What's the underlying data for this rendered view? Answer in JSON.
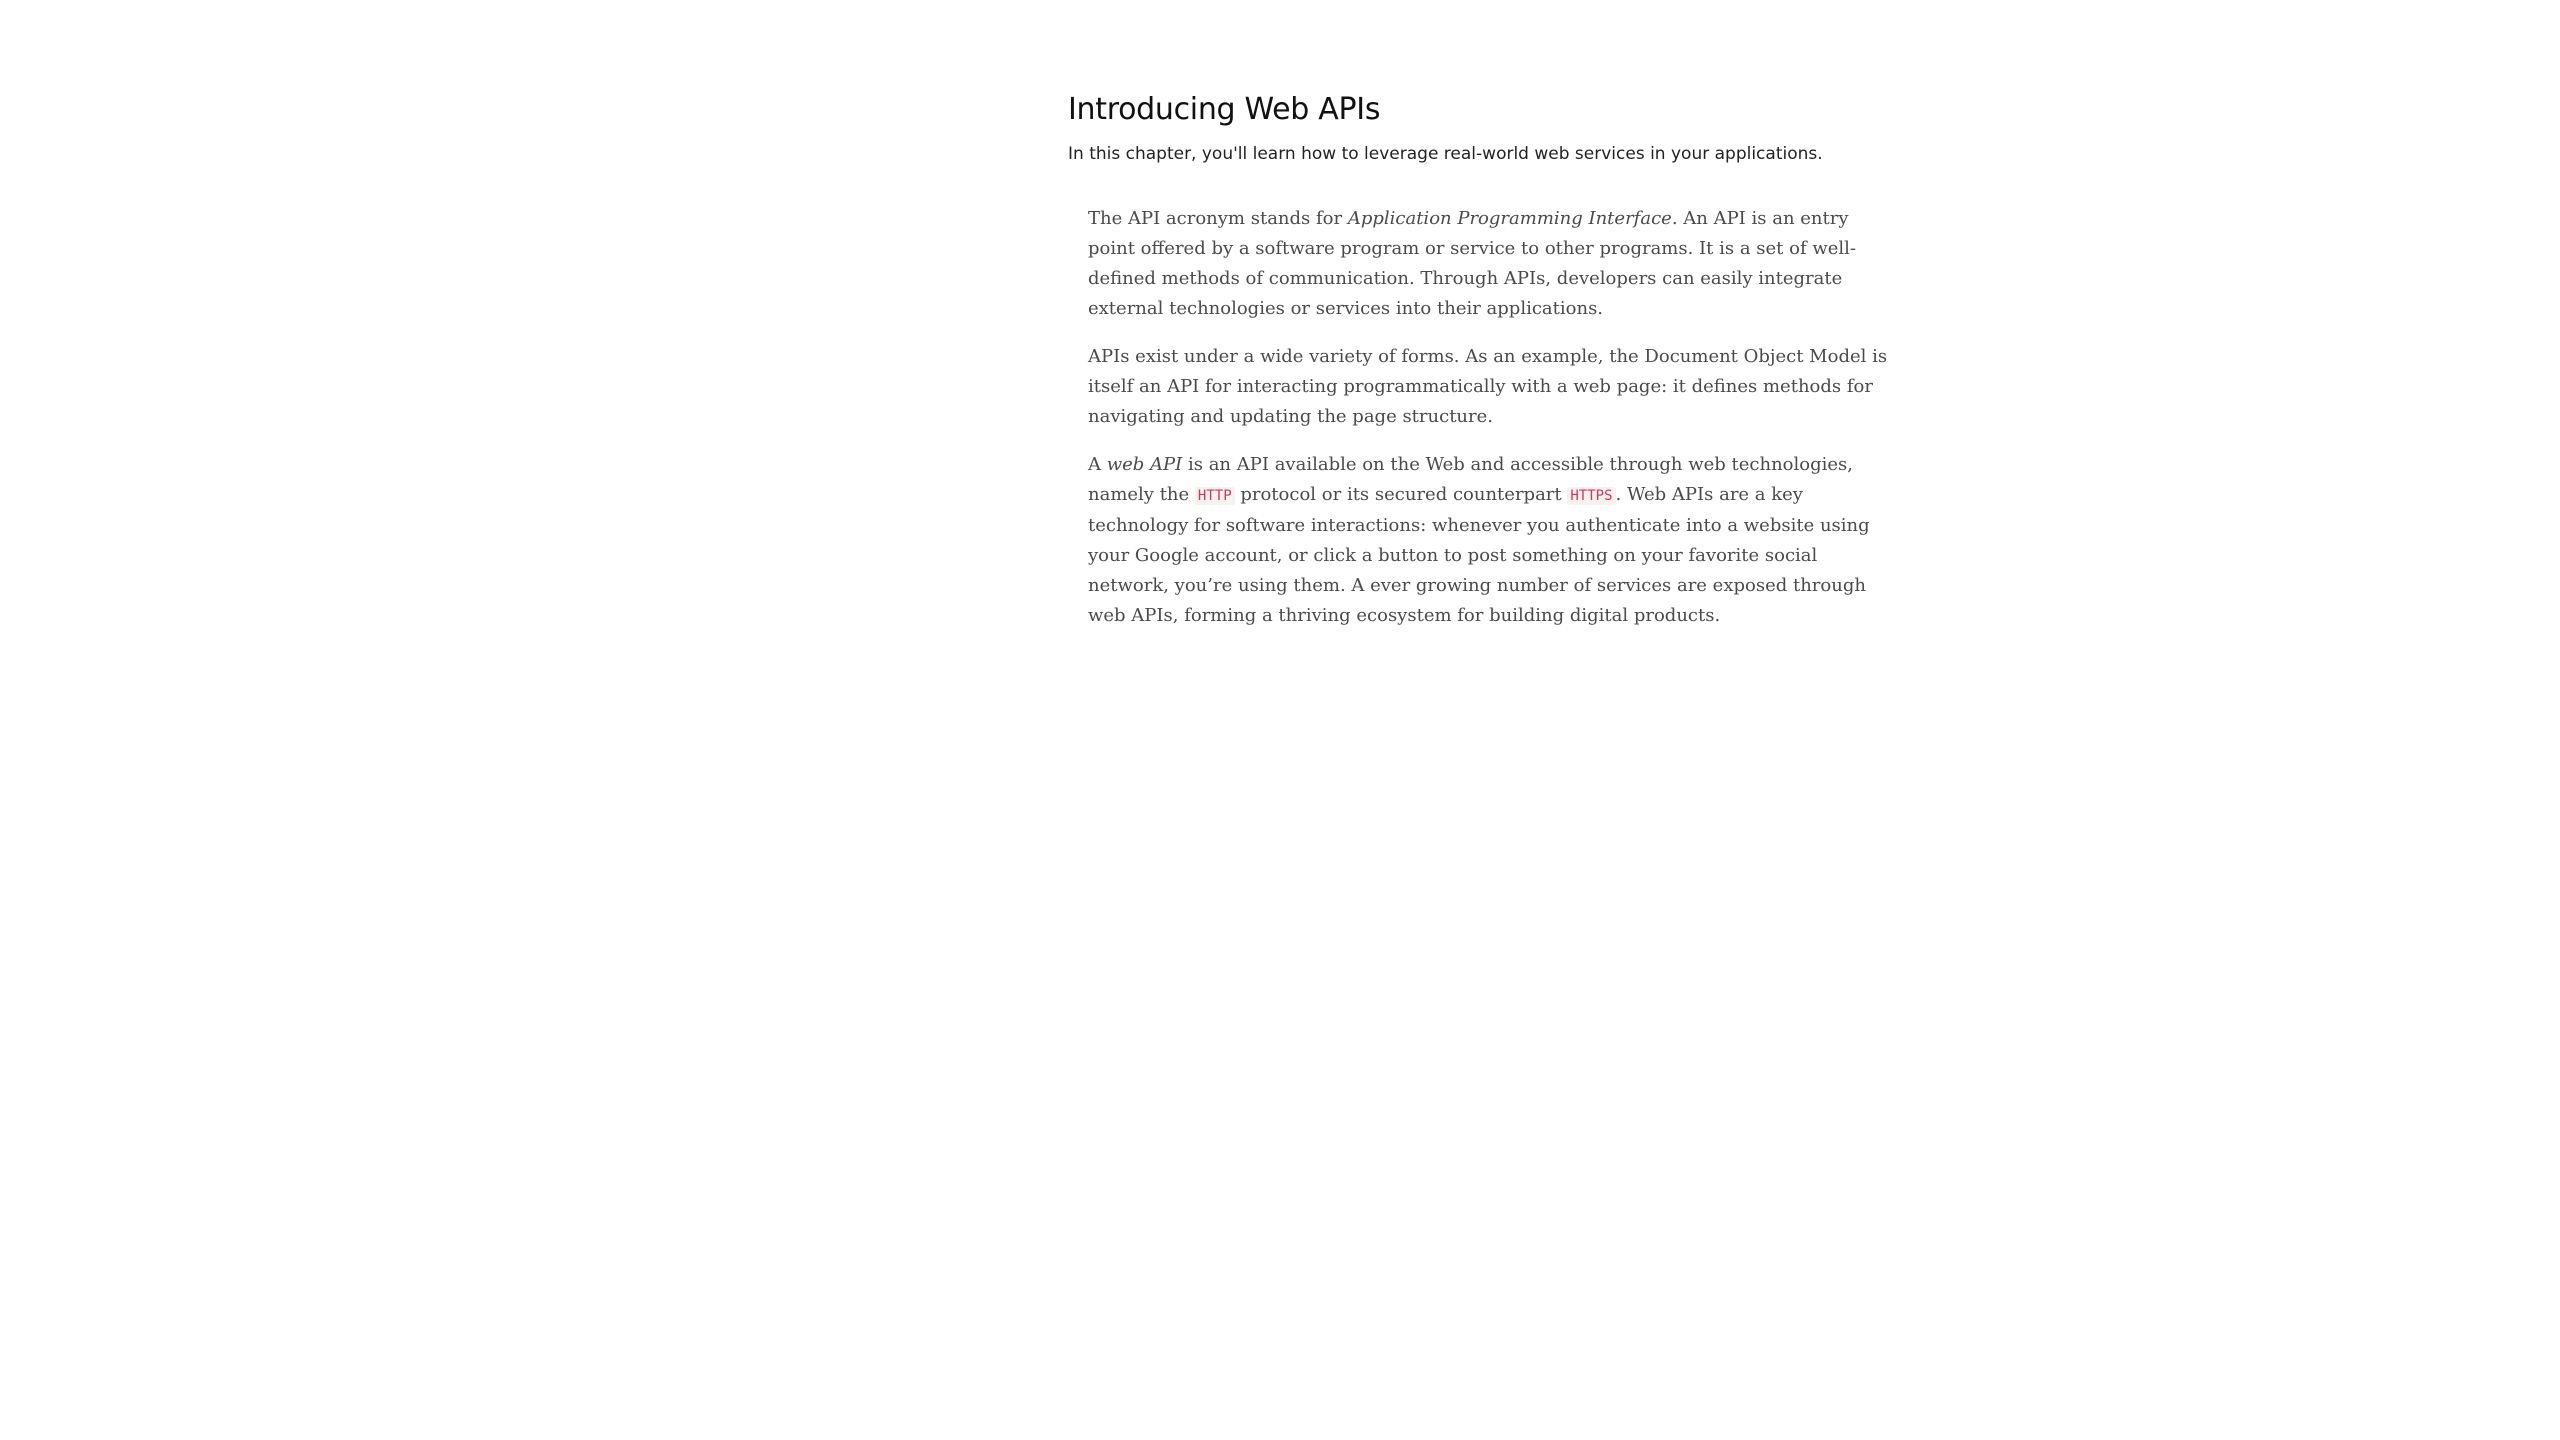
{
  "chapter": {
    "title": "Introducing Web APIs",
    "subtitle": "In this chapter, you'll learn how to leverage real-world web services in your applications."
  },
  "paragraphs": {
    "p1": {
      "t1": "The API acronym stands for ",
      "em1": "Application Programming Interface",
      "t2": ". An API is an entry point offered by a software program or service to other programs. It is a set of well-defined methods of communication. Through APIs, developers can easily integrate external technologies or services into their applications."
    },
    "p2": {
      "t1": "APIs exist under a wide variety of forms. As an example, the Document Object Model is itself an API for interacting programmatically with a web page: it defines methods for navigating and updating the page structure."
    },
    "p3": {
      "t1": "A ",
      "em1": "web API",
      "t2": " is an API available on the Web and accessible through web technologies, namely the ",
      "code1": "HTTP",
      "t3": " protocol or its secured counterpart ",
      "code2": "HTTPS",
      "t4": ". Web APIs are a key technology for software interactions: whenever you authenticate into a website using your Google account, or click a button to post something on your favorite social network, you’re using them. A ever growing number of services are exposed through web APIs, forming a thriving ecosystem for building digital products."
    }
  }
}
